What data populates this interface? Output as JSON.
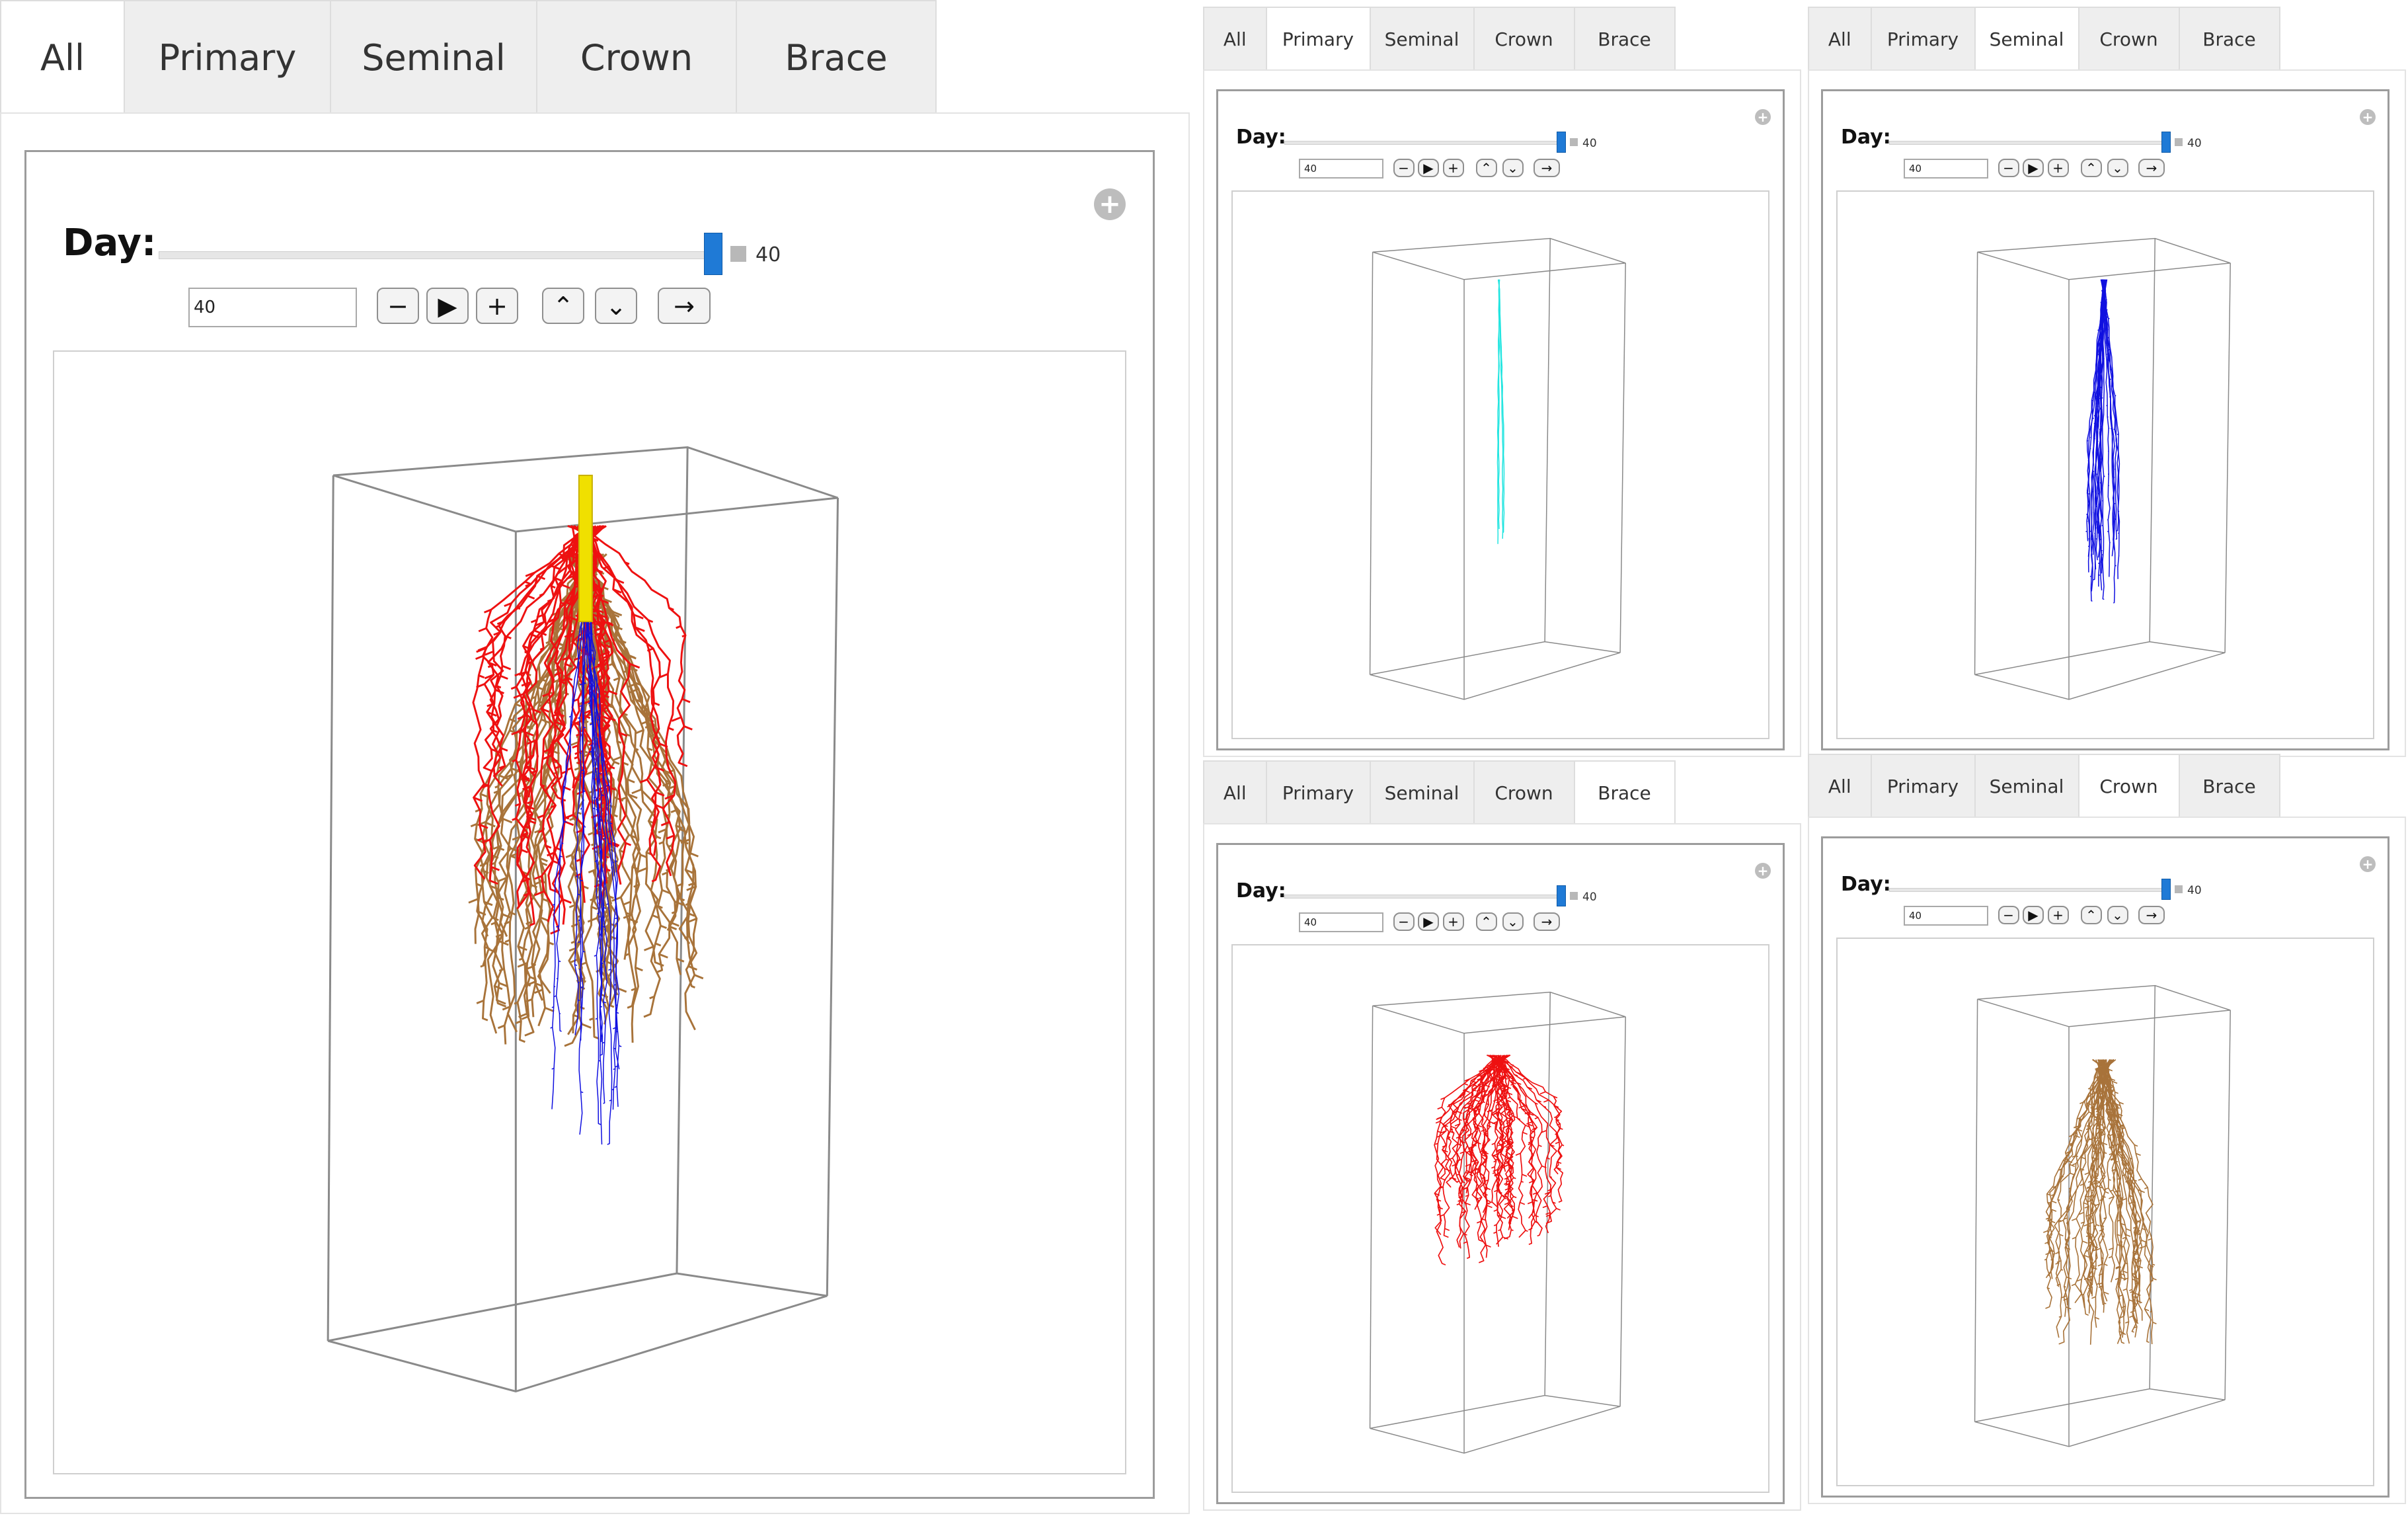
{
  "tabs": [
    "All",
    "Primary",
    "Seminal",
    "Crown",
    "Brace"
  ],
  "controls": {
    "day_label": "Day:",
    "day_value": "40",
    "day_input_value": "40",
    "slider_fraction": 1.0,
    "buttons": [
      "minus-icon",
      "play-icon",
      "plus-icon",
      "double-up-icon",
      "double-down-icon",
      "arrow-right-icon"
    ]
  },
  "colors": {
    "primary_root": "#22e5e0",
    "seminal_root": "#1010e0",
    "crown_root": "#ee1111",
    "brace_root": "#a8733a",
    "stem": "#f0e000",
    "slider_thumb": "#1f7ad6"
  },
  "widgets": [
    {
      "id": "main",
      "active_tab": "All",
      "visible_roots": [
        "crown",
        "brace",
        "seminal",
        "stem"
      ]
    },
    {
      "id": "primary",
      "active_tab": "Primary",
      "visible_roots": [
        "primary"
      ]
    },
    {
      "id": "seminal",
      "active_tab": "Seminal",
      "visible_roots": [
        "seminal"
      ]
    },
    {
      "id": "brace",
      "active_tab": "Brace",
      "visible_roots": [
        "crown"
      ]
    },
    {
      "id": "crown",
      "active_tab": "Crown",
      "visible_roots": [
        "brace"
      ]
    }
  ]
}
